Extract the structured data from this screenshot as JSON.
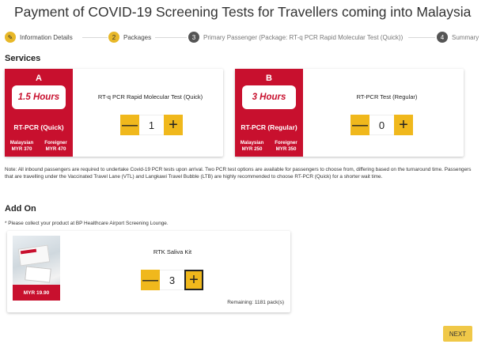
{
  "page": {
    "title": "Payment of COVID-19 Screening Tests for Travellers coming into Malaysia"
  },
  "steps": [
    {
      "label": "Information Details",
      "marker": "✎",
      "state": "done"
    },
    {
      "label": "Packages",
      "marker": "2",
      "state": "active"
    },
    {
      "label": "Primary Passenger (Package: RT-q PCR Rapid Molecular Test (Quick))",
      "marker": "3",
      "state": "todo"
    },
    {
      "label": "Summary",
      "marker": "4",
      "state": "todo"
    }
  ],
  "services": {
    "heading": "Services",
    "items": [
      {
        "letter": "A",
        "hours": "1.5 Hours",
        "code": "RT-PCR (Quick)",
        "malaysian_label": "Malaysian",
        "malaysian_price": "MYR 370",
        "foreigner_label": "Foreigner",
        "foreigner_price": "MYR 470",
        "name": "RT-q PCR Rapid Molecular Test (Quick)",
        "quantity": "1"
      },
      {
        "letter": "B",
        "hours": "3 Hours",
        "code": "RT-PCR (Regular)",
        "malaysian_label": "Malaysian",
        "malaysian_price": "MYR 250",
        "foreigner_label": "Foreigner",
        "foreigner_price": "MYR 350",
        "name": "RT-PCR Test (Regular)",
        "quantity": "0"
      }
    ],
    "note": "Note: All inbound passengers are required to undertake Covid-19 PCR tests upon arrival. Two PCR test options are available for passengers to choose from, differing based on the turnaround time. Passengers that are travelling under the Vaccinated Travel Lane (VTL) and Langkawi Travel Bubble (LTB) are highly recommended to choose RT-PCR (Quick) for a shorter wait time."
  },
  "addon": {
    "heading": "Add On",
    "note": "* Please collect your product at BP Healthcare Airport Screening Lounge.",
    "item": {
      "name": "RTK Saliva Kit",
      "price": "MYR 19.90",
      "quantity": "3",
      "remaining": "Remaining: 1181 pack(s)"
    }
  },
  "controls": {
    "minus": "—",
    "plus": "+",
    "next": "NEXT"
  },
  "colors": {
    "brand_red": "#c8102e",
    "accent_yellow": "#f0b81c",
    "next_yellow": "#f0c848"
  }
}
